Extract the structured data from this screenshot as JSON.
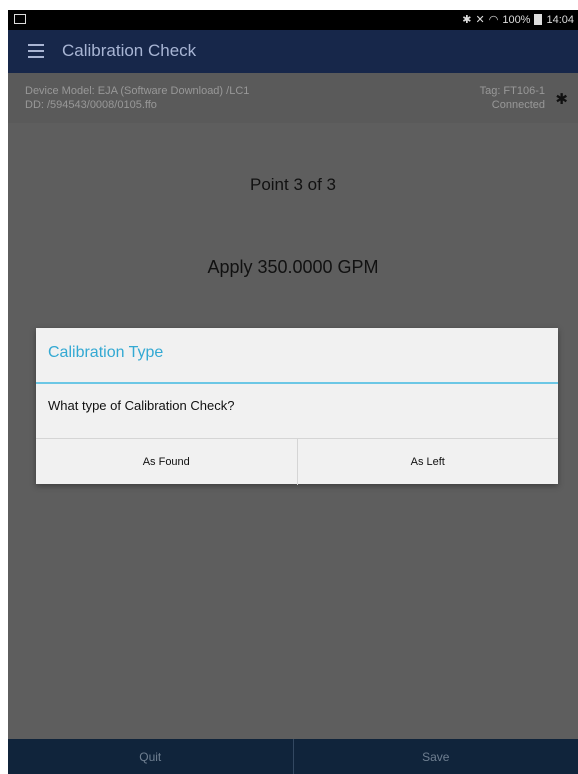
{
  "statusbar": {
    "left_icon": "gallery-icon",
    "right_icons": [
      "bluetooth-icon",
      "mute-icon",
      "wifi-icon"
    ],
    "battery": "100%",
    "time": "14:04"
  },
  "toolbar": {
    "menu_icon": "hamburger-menu-icon",
    "title": "Calibration Check"
  },
  "device": {
    "model_line": "Device Model:  EJA (Software Download) /LC1",
    "dd_line": "DD:  /594543/0008/0105.ffo",
    "tag_line": "Tag:  FT106-1",
    "connection_status": "Connected",
    "bluetooth_icon": "bluetooth-icon"
  },
  "main": {
    "point_text": "Point 3 of 3",
    "apply_text": "Apply 350.0000 GPM"
  },
  "dialog": {
    "title": "Calibration Type",
    "message": "What type of Calibration Check?",
    "buttons": {
      "as_found": "As Found",
      "as_left": "As Left"
    }
  },
  "bottombar": {
    "quit": "Quit",
    "save": "Save"
  },
  "colors": {
    "toolbar_bg": "#17274a",
    "dialog_accent": "#33a9d3",
    "bottom_bg": "#10243b"
  }
}
